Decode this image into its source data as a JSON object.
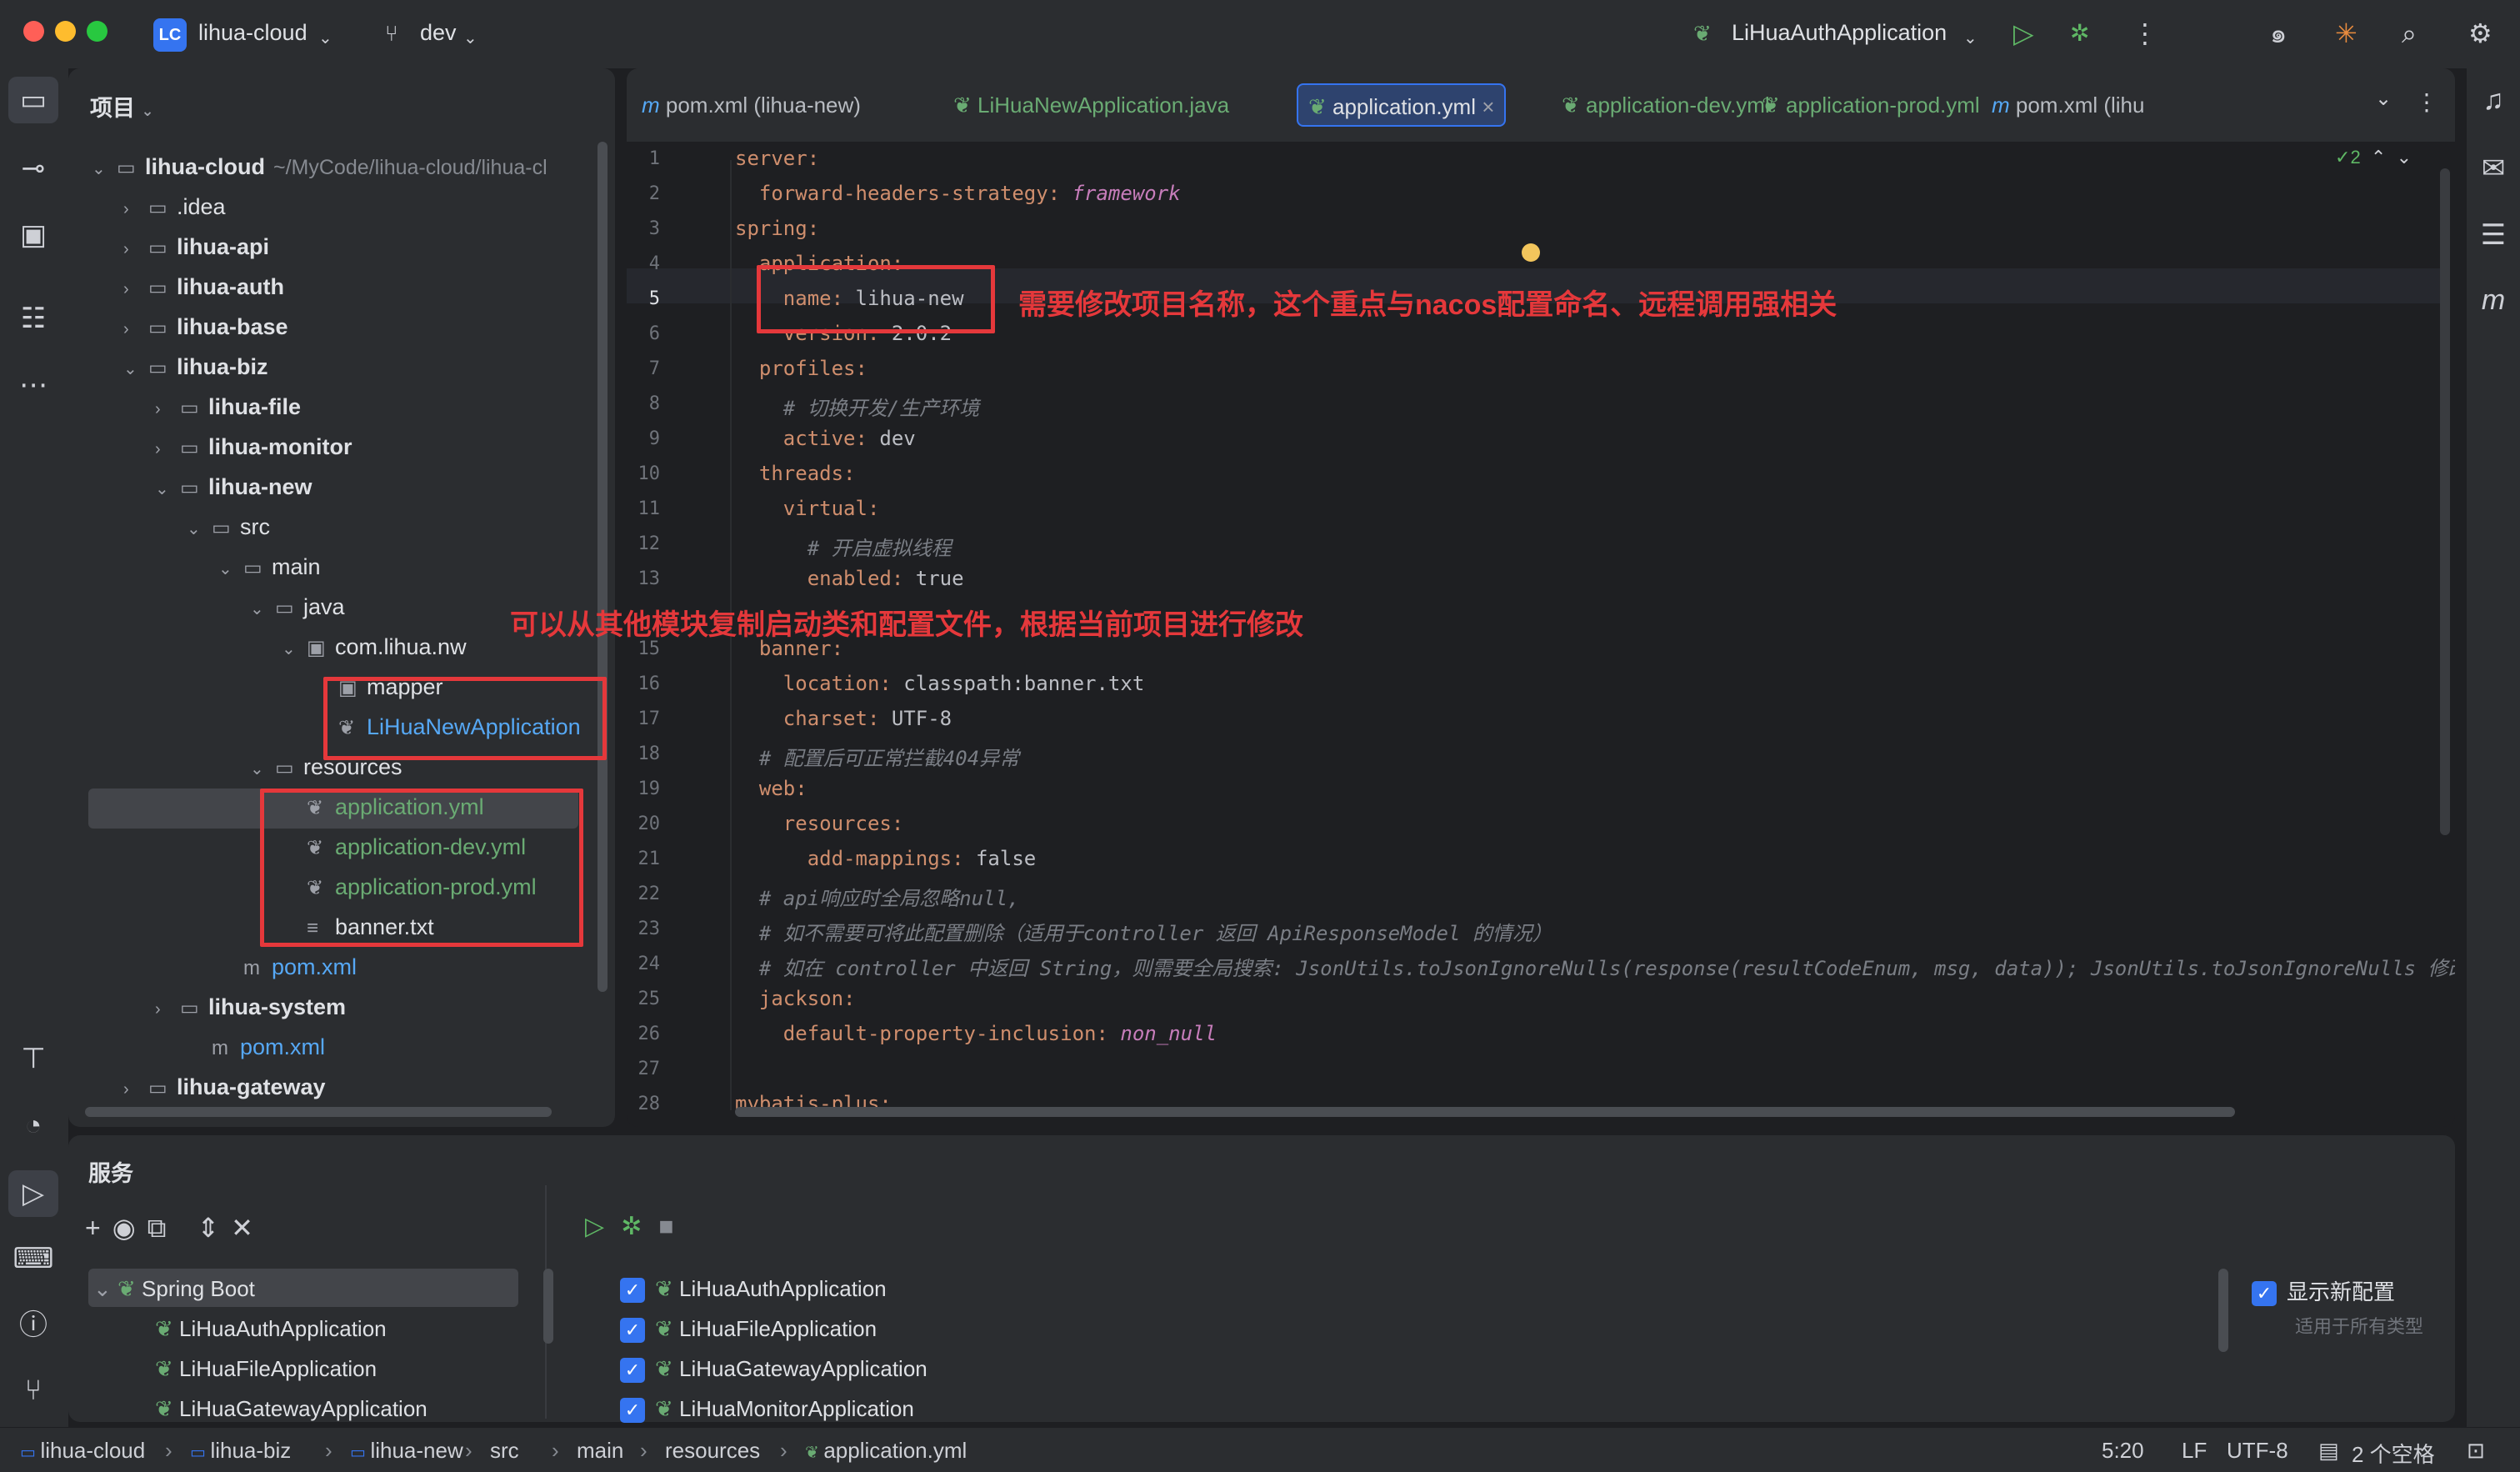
{
  "titlebar": {
    "project_badge": "LC",
    "project_name": "lihua-cloud",
    "branch": "dev",
    "run_config": "LiHuaAuthApplication"
  },
  "project_panel": {
    "header": "项目",
    "tree": [
      {
        "label": "lihua-cloud",
        "suffix": "~/MyCode/lihua-cloud/lihua-cl",
        "bold": true
      },
      {
        "label": ".idea"
      },
      {
        "label": "lihua-api",
        "bold": true
      },
      {
        "label": "lihua-auth",
        "bold": true
      },
      {
        "label": "lihua-base",
        "bold": true
      },
      {
        "label": "lihua-biz",
        "bold": true
      },
      {
        "label": "lihua-file",
        "bold": true
      },
      {
        "label": "lihua-monitor",
        "bold": true
      },
      {
        "label": "lihua-new",
        "bold": true
      },
      {
        "label": "src"
      },
      {
        "label": "main"
      },
      {
        "label": "java"
      },
      {
        "label": "com.lihua.nw"
      },
      {
        "label": "mapper"
      },
      {
        "label": "LiHuaNewApplication"
      },
      {
        "label": "resources"
      },
      {
        "label": "application.yml"
      },
      {
        "label": "application-dev.yml"
      },
      {
        "label": "application-prod.yml"
      },
      {
        "label": "banner.txt"
      },
      {
        "label": "pom.xml"
      },
      {
        "label": "lihua-system",
        "bold": true
      },
      {
        "label": "pom.xml"
      },
      {
        "label": "lihua-gateway",
        "bold": true
      }
    ]
  },
  "editor": {
    "tabs": [
      {
        "label": "pom.xml (lihua-new)"
      },
      {
        "label": "LiHuaNewApplication.java"
      },
      {
        "label": "application.yml"
      },
      {
        "label": "application-dev.yml"
      },
      {
        "label": "application-prod.yml"
      },
      {
        "label": "pom.xml (lihu"
      }
    ],
    "inspection_count": "2",
    "line_numbers": [
      "1",
      "2",
      "3",
      "4",
      "5",
      "6",
      "7",
      "8",
      "9",
      "10",
      "11",
      "12",
      "13",
      "",
      "15",
      "16",
      "17",
      "18",
      "19",
      "20",
      "21",
      "22",
      "23",
      "24",
      "25",
      "26",
      "27",
      "28"
    ],
    "lines": [
      {
        "k": "server:"
      },
      {
        "k": "  forward-headers-strategy: ",
        "v": "framework",
        "vs": "it"
      },
      {
        "k": "spring:"
      },
      {
        "k": "  application:"
      },
      {
        "k": "    name: ",
        "v": "lihua-new"
      },
      {
        "k": "    version: ",
        "v": "2.0.2"
      },
      {
        "k": "  profiles:"
      },
      {
        "c": "    # 切换开发/生产环境"
      },
      {
        "k": "    active: ",
        "v": "dev"
      },
      {
        "k": "  threads:"
      },
      {
        "k": "    virtual:"
      },
      {
        "c": "      # 开启虚拟线程"
      },
      {
        "k": "      enabled: ",
        "v": "true"
      },
      {
        "k": ""
      },
      {
        "k": "  banner:"
      },
      {
        "k": "    location: ",
        "v": "classpath:banner.txt"
      },
      {
        "k": "    charset: ",
        "v": "UTF-8"
      },
      {
        "c": "  # 配置后可正常拦截404异常"
      },
      {
        "k": "  web:"
      },
      {
        "k": "    resources:"
      },
      {
        "k": "      add-mappings: ",
        "v": "false"
      },
      {
        "c": "  # api响应时全局忽略null,"
      },
      {
        "c": "  # 如不需要可将此配置删除（适用于controller 返回 ApiResponseModel 的情况）"
      },
      {
        "c": "  # 如在 controller 中返回 String，则需要全局搜索: JsonUtils.toJsonIgnoreNulls(response(resultCodeEnum, msg, data)); JsonUtils.toJsonIgnoreNulls 修改"
      },
      {
        "k": "  jackson:"
      },
      {
        "k": "    default-property-inclusion: ",
        "v": "non_null",
        "vs": "it"
      },
      {
        "k": ""
      },
      {
        "k": "mybatis-plus:"
      }
    ]
  },
  "annotations": {
    "name_note": "需要修改项目名称，这个重点与nacos配置命名、远程调用强相关",
    "copy_note": "可以从其他模块复制启动类和配置文件，根据当前项目进行修改"
  },
  "services": {
    "header": "服务",
    "tree_root": "Spring Boot",
    "tree_items": [
      "LiHuaAuthApplication",
      "LiHuaFileApplication",
      "LiHuaGatewayApplication"
    ],
    "checklist": [
      "LiHuaAuthApplication",
      "LiHuaFileApplication",
      "LiHuaGatewayApplication",
      "LiHuaMonitorApplication"
    ],
    "show_new_config": "显示新配置",
    "applies_to_all": "适用于所有类型"
  },
  "statusbar": {
    "breadcrumbs": [
      "lihua-cloud",
      "lihua-biz",
      "lihua-new",
      "src",
      "main",
      "resources",
      "application.yml"
    ],
    "cursor": "5:20",
    "line_ending": "LF",
    "encoding": "UTF-8",
    "indent": "2 个空格"
  },
  "colors": {
    "accent": "#3574f0",
    "annotation_red": "#e5383b",
    "spring_green": "#6aab73"
  }
}
